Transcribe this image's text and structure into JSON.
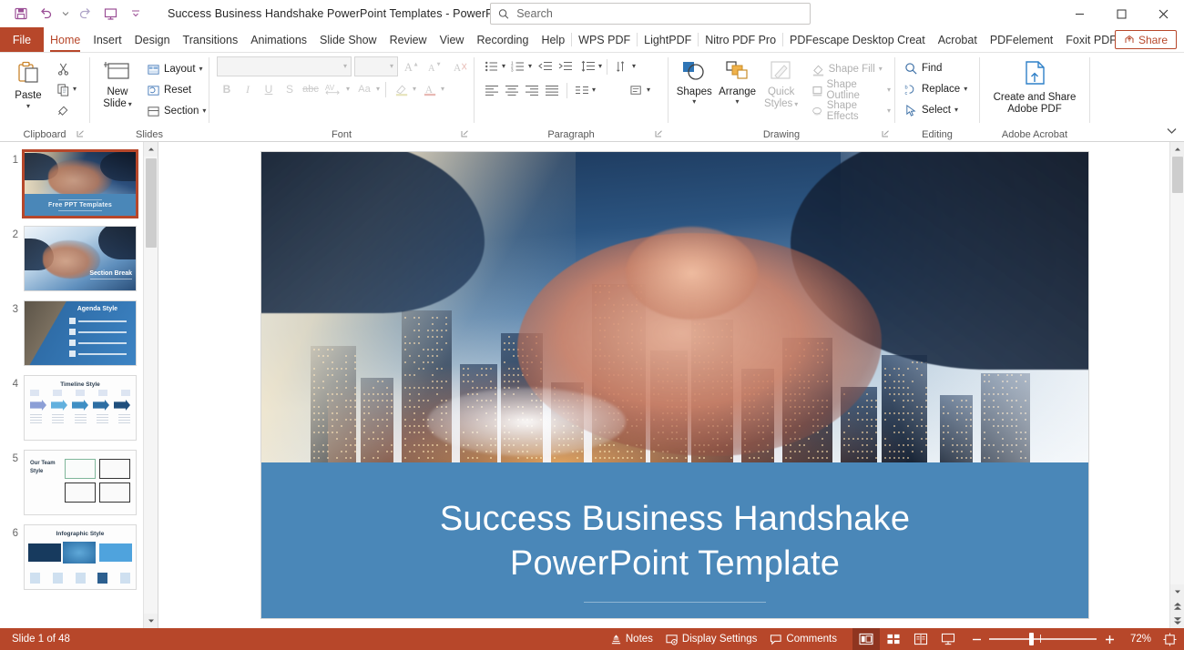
{
  "titlebar": {
    "document_title": "Success Business Handshake PowerPoint Templates  -  PowerPoint",
    "quick_access": [
      {
        "name": "save",
        "label": "Save"
      },
      {
        "name": "undo",
        "label": "Undo"
      },
      {
        "name": "redo",
        "label": "Redo"
      },
      {
        "name": "start-from-beginning",
        "label": "Start From Beginning"
      },
      {
        "name": "customize-quick-access-toolbar",
        "label": "Customize Quick Access Toolbar"
      }
    ],
    "search_placeholder": "Search",
    "window_controls": [
      {
        "name": "minimize",
        "label": "Minimize"
      },
      {
        "name": "restore",
        "label": "Restore Down"
      },
      {
        "name": "close",
        "label": "Close"
      }
    ]
  },
  "tabs": {
    "file": "File",
    "items": [
      {
        "label": "Home",
        "active": true
      },
      {
        "label": "Insert",
        "active": false
      },
      {
        "label": "Design",
        "active": false
      },
      {
        "label": "Transitions",
        "active": false
      },
      {
        "label": "Animations",
        "active": false
      },
      {
        "label": "Slide Show",
        "active": false
      },
      {
        "label": "Review",
        "active": false
      },
      {
        "label": "View",
        "active": false
      },
      {
        "label": "Recording",
        "active": false
      },
      {
        "label": "Help",
        "active": false
      },
      {
        "label": "WPS PDF",
        "active": false
      },
      {
        "label": "LightPDF",
        "active": false
      },
      {
        "label": "Nitro PDF Pro",
        "active": false
      },
      {
        "label": "PDFescape Desktop Creat",
        "active": false
      },
      {
        "label": "Acrobat",
        "active": false
      },
      {
        "label": "PDFelement",
        "active": false
      },
      {
        "label": "Foxit PDF",
        "active": false
      }
    ],
    "share": "Share"
  },
  "ribbon": {
    "groups": [
      {
        "name": "clipboard",
        "label": "Clipboard",
        "paste": "Paste",
        "cut": "Cut",
        "copy": "Copy",
        "format_painter": "Format Painter"
      },
      {
        "name": "slides",
        "label": "Slides",
        "new_slide": "New\nSlide",
        "new_slide_line1": "New",
        "new_slide_line2": "Slide",
        "layout": "Layout",
        "reset": "Reset",
        "section": "Section"
      },
      {
        "name": "font",
        "label": "Font",
        "font_name": "",
        "font_size": "",
        "increase_font_size": "Increase Font Size",
        "decrease_font_size": "Decrease Font Size",
        "clear_formatting": "Clear All Formatting",
        "bold": "B",
        "italic": "I",
        "underline": "U",
        "text_shadow": "S",
        "strikethrough": "abc",
        "character_spacing": "AV",
        "change_case": "Aa",
        "text_highlight_color": "Text Highlight Color",
        "font_color": "Font Color"
      },
      {
        "name": "paragraph",
        "label": "Paragraph",
        "bullets": "Bullets",
        "numbering": "Numbering",
        "decrease_indent": "Decrease List Level",
        "increase_indent": "Increase List Level",
        "line_spacing": "Line Spacing",
        "align_left": "Align Left",
        "center": "Center",
        "align_right": "Align Right",
        "justify": "Justify",
        "columns": "Add or Remove Columns",
        "text_direction": "Text Direction",
        "align_text": "Align Text",
        "convert_smartart": "Convert to SmartArt"
      },
      {
        "name": "drawing",
        "label": "Drawing",
        "shapes": "Shapes",
        "arrange": "Arrange",
        "quick_styles_line1": "Quick",
        "quick_styles_line2": "Styles",
        "shape_fill": "Shape Fill",
        "shape_outline": "Shape Outline",
        "shape_effects": "Shape Effects"
      },
      {
        "name": "editing",
        "label": "Editing",
        "find": "Find",
        "replace": "Replace",
        "select": "Select"
      },
      {
        "name": "adobe-acrobat",
        "label": "Adobe Acrobat",
        "create_share_line1": "Create and Share",
        "create_share_line2": "Adobe PDF"
      }
    ]
  },
  "thumbnails": {
    "slides": [
      {
        "number": "1",
        "title": "Free PPT Templates",
        "kind": "cover",
        "selected": true
      },
      {
        "number": "2",
        "title": "Section Break",
        "kind": "section",
        "selected": false
      },
      {
        "number": "3",
        "title": "Agenda Style",
        "kind": "agenda",
        "selected": false
      },
      {
        "number": "4",
        "title": "Timeline Style",
        "kind": "timeline",
        "selected": false
      },
      {
        "number": "5",
        "title": "Our Team Style",
        "kind": "team",
        "selected": false
      },
      {
        "number": "6",
        "title": "Infographic Style",
        "kind": "infographic",
        "selected": false
      }
    ]
  },
  "slide": {
    "title_line1": "Success Business Handshake",
    "title_line2": "PowerPoint Template",
    "band_color": "#4a87b8"
  },
  "statusbar": {
    "slide_counter": "Slide 1 of 48",
    "notes": "Notes",
    "display_settings": "Display Settings",
    "comments": "Comments",
    "views": [
      {
        "name": "normal-view",
        "label": "Normal",
        "active": true
      },
      {
        "name": "slide-sorter-view",
        "label": "Slide Sorter",
        "active": false
      },
      {
        "name": "reading-view",
        "label": "Reading View",
        "active": false
      },
      {
        "name": "slide-show-view",
        "label": "Slide Show",
        "active": false
      }
    ],
    "zoom_out": "Zoom Out",
    "zoom_in": "Zoom In",
    "zoom_level": "72%",
    "fit_to_window": "Fit slide to current window"
  },
  "colors": {
    "accent": "#b7472a",
    "slide_band": "#4a87b8",
    "file_tab": "#b7472a"
  }
}
